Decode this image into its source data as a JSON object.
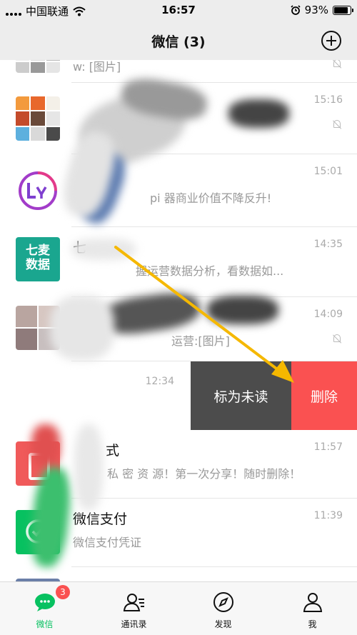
{
  "status_bar": {
    "carrier": "中国联通",
    "time": "16:57",
    "battery": "93%",
    "battery_level": 0.93
  },
  "nav": {
    "title": "微信 (3)",
    "add_icon": "plus-circle-icon"
  },
  "chats": [
    {
      "preview": "w: [图片]",
      "muted": true
    },
    {
      "time": "15:16",
      "muted": true
    },
    {
      "time": "15:01",
      "preview": "pi 器商业价值不降反升!"
    },
    {
      "avatar_text": [
        "七麦",
        "数据"
      ],
      "name": "七",
      "time": "14:35",
      "preview": "握运营数据分析，看数据如..."
    },
    {
      "time": "14:09",
      "preview": "运营:[图片]",
      "muted": true
    },
    {
      "time": "12:34"
    },
    {
      "name": "式",
      "time": "11:57",
      "preview": "私 密 资 源！第一次分享！随时删除！"
    },
    {
      "name": "微信支付",
      "time": "11:39",
      "preview": "微信支付凭证"
    }
  ],
  "swipe_actions": {
    "mark_unread": "标为未读",
    "delete": "删除"
  },
  "tabs": [
    {
      "label": "微信",
      "icon": "chat-bubble-icon",
      "badge": "3",
      "active": true
    },
    {
      "label": "通讯录",
      "icon": "contacts-icon"
    },
    {
      "label": "发现",
      "icon": "compass-icon"
    },
    {
      "label": "我",
      "icon": "person-icon"
    }
  ],
  "colors": {
    "accent_green": "#07c160",
    "delete_red": "#fa5151",
    "mark_unread_gray": "#4c4c4c",
    "annotation_arrow": "#f5b800"
  }
}
